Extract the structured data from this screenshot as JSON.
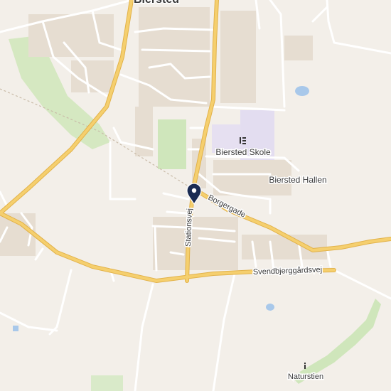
{
  "map": {
    "place_labels": {
      "town": "Biersted",
      "school": "Biersted Skole",
      "hall": "Biersted Hallen",
      "trail": "Naturstien"
    },
    "road_labels": {
      "stationsvej": "Stationsvej",
      "borgergade": "Borgergade",
      "svendbjerggardsvej": "Svendbjerggårdsvej"
    },
    "colors": {
      "land": "#f3efe9",
      "major_road": "#f5cf6e",
      "major_road_casing": "#e2b24a",
      "minor_road": "#ffffff",
      "park": "#cfe6bb",
      "school_area": "#e3ddf0",
      "water": "#a8c8ea",
      "building": "#e8e0d6",
      "marker": "#1a2b52",
      "label_text": "#4a4a4a"
    },
    "icons": {
      "marker": "location-pin-icon",
      "school": "school-icon",
      "trail": "info-icon"
    }
  }
}
